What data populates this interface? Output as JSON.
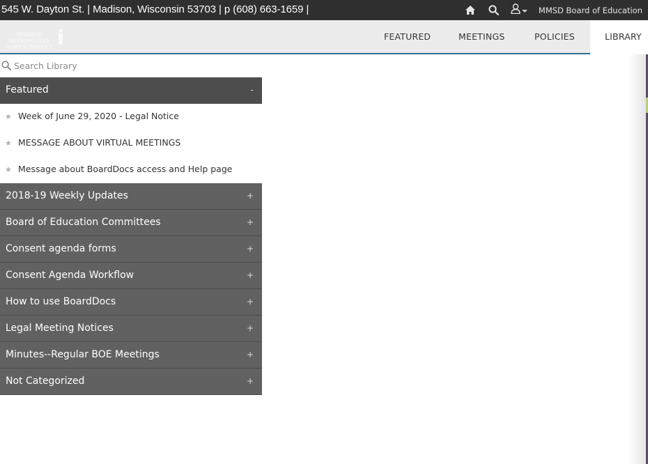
{
  "topbar": {
    "address": "545 W. Dayton St. | Madison, Wisconsin 53703 | p (608) 663-1659 |",
    "icons": {
      "home": "home-icon",
      "search": "search-icon",
      "user": "user-icon"
    },
    "org_name": "MMSD Board of Education"
  },
  "logo": {
    "line1": "MADISON METROPOLITAN",
    "line2": "SCHOOL DISTRICT"
  },
  "nav": {
    "tabs": [
      "FEATURED",
      "MEETINGS",
      "POLICIES",
      "LIBRARY"
    ],
    "active": "LIBRARY"
  },
  "search": {
    "placeholder": "Search Library"
  },
  "library": {
    "featured": {
      "title": "Featured",
      "toggle": "-",
      "items": [
        "Week of June 29, 2020 - Legal Notice",
        "MESSAGE ABOUT VIRTUAL MEETINGS",
        "Message about BoardDocs access and Help page"
      ]
    },
    "sections": [
      {
        "title": "2018-19 Weekly Updates",
        "toggle": "+"
      },
      {
        "title": "Board of Education Committees",
        "toggle": "+"
      },
      {
        "title": "Consent agenda forms",
        "toggle": "+"
      },
      {
        "title": "Consent Agenda Workflow",
        "toggle": "+"
      },
      {
        "title": "How to use BoardDocs",
        "toggle": "+"
      },
      {
        "title": "Legal Meeting Notices",
        "toggle": "+"
      },
      {
        "title": "Minutes--Regular BOE Meetings",
        "toggle": "+"
      },
      {
        "title": "Not Categorized",
        "toggle": "+"
      }
    ]
  },
  "colors": {
    "topbar": "#2f2f2f",
    "navbar": "#ececec",
    "nav_underline": "#2f6f93",
    "section_header": "#616161",
    "featured_header": "#4d4d4d"
  }
}
